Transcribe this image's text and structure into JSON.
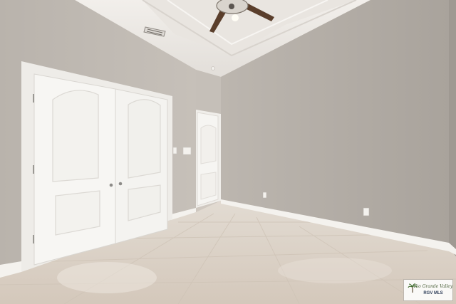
{
  "scene": {
    "description_kind": "photo",
    "colors": {
      "left_wall": "#bdb7b0",
      "right_wall": "#b3ada6",
      "back_wall": "#c4beb7",
      "ceiling": "#ece9e5",
      "floor": "#ddd3c8",
      "doors": "#f6f5f2",
      "baseboard": "#f3f1ed"
    },
    "icons": [
      "ceiling-fan-icon",
      "air-vent-icon",
      "light-switch-icon",
      "power-outlet-icon",
      "palm-tree-icon"
    ]
  },
  "watermark": {
    "brand": "Rio Grande Valley",
    "mls": "RGV MLS"
  }
}
